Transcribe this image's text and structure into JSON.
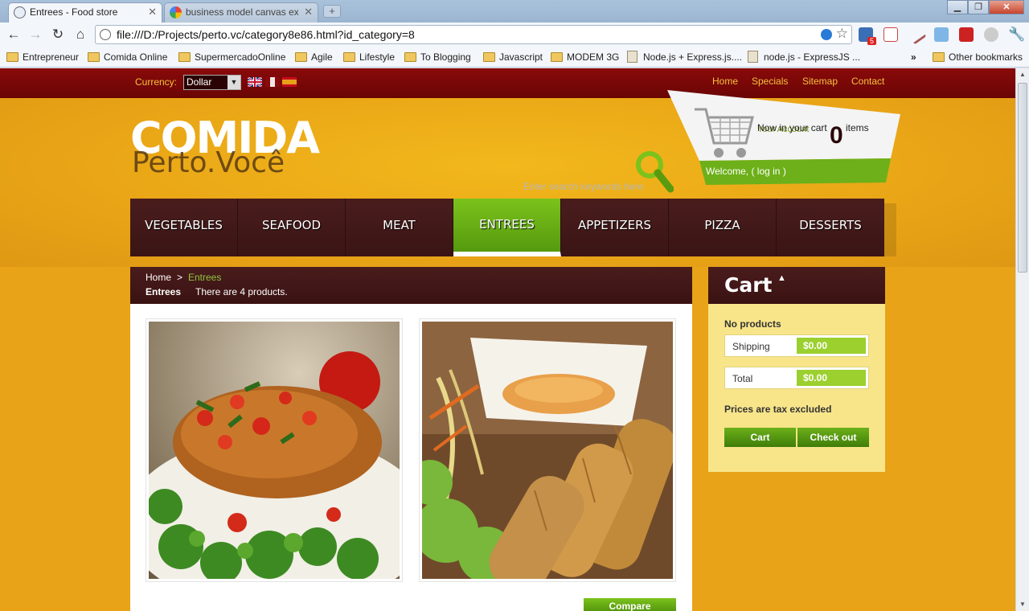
{
  "browser": {
    "tabs": [
      {
        "title": "Entrees - Food store",
        "active": true
      },
      {
        "title": "business model canvas exar",
        "active": false
      }
    ],
    "url": "file:///D:/Projects/perto.vc/category8e86.html?id_category=8",
    "bookmarks": [
      {
        "label": "Entrepreneur",
        "type": "folder"
      },
      {
        "label": "Comida Online",
        "type": "folder"
      },
      {
        "label": "SupermercadoOnline",
        "type": "folder"
      },
      {
        "label": "Agile",
        "type": "folder"
      },
      {
        "label": "Lifestyle",
        "type": "folder"
      },
      {
        "label": "To Blogging",
        "type": "folder"
      },
      {
        "label": "Javascript",
        "type": "folder"
      },
      {
        "label": "MODEM 3G",
        "type": "folder"
      },
      {
        "label": "Node.js + Express.js....",
        "type": "page"
      },
      {
        "label": "node.js - ExpressJS ...",
        "type": "page"
      },
      {
        "label": "Other bookmarks",
        "type": "folder"
      }
    ],
    "overflow_label": "»",
    "ext_badge": "5"
  },
  "topbar": {
    "currency_label": "Currency:",
    "currency_value": "Dollar",
    "links": [
      "Home",
      "Specials",
      "Sitemap",
      "Contact"
    ]
  },
  "header": {
    "logo_main": "COMIDA",
    "logo_sub": "Perto.Você",
    "search_placeholder": "Enter search keywords here",
    "cart_now": "Now in your cart",
    "your_account": "Your Account",
    "cart_count": "0",
    "cart_items_label": "items",
    "welcome": "Welcome, ( log in )"
  },
  "menu": {
    "items": [
      "VEGETABLES",
      "SEAFOOD",
      "MEAT",
      "ENTREES",
      "APPETIZERS",
      "PIZZA",
      "DESSERTS"
    ],
    "active": "ENTREES"
  },
  "content": {
    "breadcrumb_home": "Home",
    "breadcrumb_sep": ">",
    "breadcrumb_current": "Entrees",
    "category_name": "Entrees",
    "product_count_text": "There are 4 products.",
    "compare_label": "Compare"
  },
  "cart_block": {
    "title": "Cart",
    "toggle_glyph": "▲",
    "no_products": "No products",
    "shipping_label": "Shipping",
    "shipping_value": "$0.00",
    "total_label": "Total",
    "total_value": "$0.00",
    "tax_note": "Prices are tax excluded",
    "cart_button": "Cart",
    "checkout_button": "Check out"
  },
  "colors": {
    "page_bg": "#e8a318",
    "top_bar": "#7a0808",
    "menu_bg": "#3f1818",
    "accent_green": "#6db01a",
    "cart_body": "#f8e58a"
  }
}
